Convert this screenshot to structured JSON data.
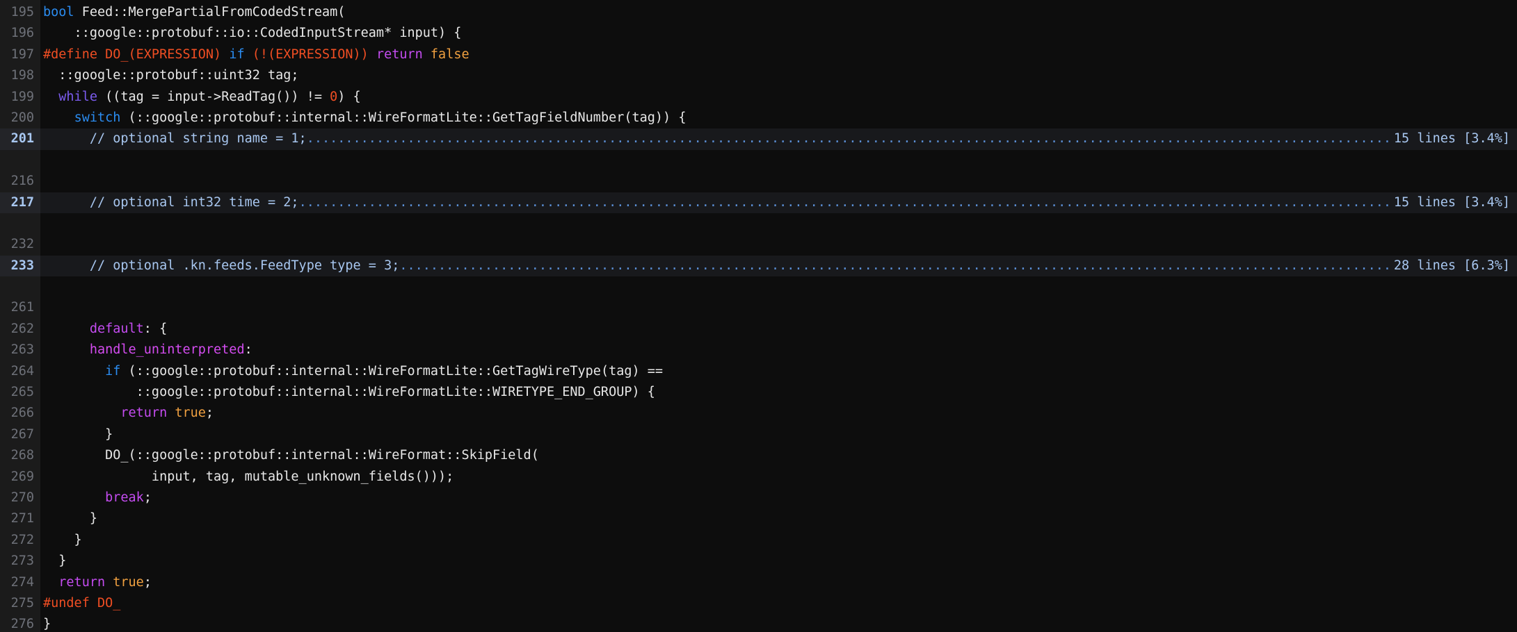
{
  "editor": {
    "theme": "dark",
    "language": "cpp",
    "font": "monospace",
    "colors": {
      "background": "#0d0d0d",
      "gutter_background": "#1b1b1b",
      "foreground": "#e8e8e8",
      "line_number": "#6e7179",
      "fold_text": "#a8c7f0",
      "fold_row_background": "#18191c",
      "preprocessor": "#f04e23",
      "type_keyword": "#2b8cf0",
      "control_keyword": "#c44cf0",
      "loop_keyword": "#7c5cf0",
      "constant": "#f0a040",
      "label": "#d44cf0"
    },
    "first_line": 195,
    "last_line": 276
  },
  "lines": [
    {
      "number": "195",
      "folded": false,
      "blank": false,
      "tokens": [
        {
          "text": "bool",
          "cls": "t-type"
        },
        {
          "text": " Feed::MergePartialFromCodedStream(",
          "cls": "t-plain"
        }
      ]
    },
    {
      "number": "196",
      "folded": false,
      "blank": false,
      "tokens": [
        {
          "text": "    ::google::protobuf::io::CodedInputStream* input) {",
          "cls": "t-plain"
        }
      ]
    },
    {
      "number": "197",
      "folded": false,
      "blank": false,
      "tokens": [
        {
          "text": "#define DO_(EXPRESSION) ",
          "cls": "t-pre"
        },
        {
          "text": "if",
          "cls": "t-type"
        },
        {
          "text": " ",
          "cls": "t-plain"
        },
        {
          "text": "(!(EXPRESSION))",
          "cls": "t-pre"
        },
        {
          "text": " ",
          "cls": "t-plain"
        },
        {
          "text": "return",
          "cls": "t-kw"
        },
        {
          "text": " ",
          "cls": "t-plain"
        },
        {
          "text": "false",
          "cls": "t-const"
        }
      ]
    },
    {
      "number": "198",
      "folded": false,
      "blank": false,
      "tokens": [
        {
          "text": "  ::google::protobuf::uint32 tag;",
          "cls": "t-plain"
        }
      ]
    },
    {
      "number": "199",
      "folded": false,
      "blank": false,
      "tokens": [
        {
          "text": "  ",
          "cls": "t-plain"
        },
        {
          "text": "while",
          "cls": "t-kw2"
        },
        {
          "text": " ((tag = input->ReadTag()) != ",
          "cls": "t-plain"
        },
        {
          "text": "0",
          "cls": "t-num"
        },
        {
          "text": ") {",
          "cls": "t-plain"
        }
      ]
    },
    {
      "number": "200",
      "folded": false,
      "blank": false,
      "tokens": [
        {
          "text": "    ",
          "cls": "t-plain"
        },
        {
          "text": "switch",
          "cls": "t-type"
        },
        {
          "text": " (::google::protobuf::internal::WireFormatLite::GetTagFieldNumber(tag)) {",
          "cls": "t-plain"
        }
      ]
    },
    {
      "number": "201",
      "folded": true,
      "blank": false,
      "fold_text": "      // optional string name = 1;",
      "fold_meta": "15 lines [3.4%]",
      "tokens": [
        {
          "text": "      // optional string name = 1;",
          "cls": "t-fold"
        }
      ]
    },
    {
      "number": "",
      "folded": false,
      "blank": true,
      "tokens": []
    },
    {
      "number": "216",
      "folded": false,
      "blank": false,
      "tokens": [
        {
          "text": "",
          "cls": "t-plain"
        }
      ]
    },
    {
      "number": "217",
      "folded": true,
      "blank": false,
      "fold_text": "      // optional int32 time = 2;",
      "fold_meta": "15 lines [3.4%]",
      "tokens": [
        {
          "text": "      // optional int32 time = 2;",
          "cls": "t-fold"
        }
      ]
    },
    {
      "number": "",
      "folded": false,
      "blank": true,
      "tokens": []
    },
    {
      "number": "232",
      "folded": false,
      "blank": false,
      "tokens": [
        {
          "text": "",
          "cls": "t-plain"
        }
      ]
    },
    {
      "number": "233",
      "folded": true,
      "blank": false,
      "fold_text": "      // optional .kn.feeds.FeedType type = 3;",
      "fold_meta": "28 lines [6.3%]",
      "tokens": [
        {
          "text": "      // optional .kn.feeds.FeedType type = 3;",
          "cls": "t-fold"
        }
      ]
    },
    {
      "number": "",
      "folded": false,
      "blank": true,
      "tokens": []
    },
    {
      "number": "261",
      "folded": false,
      "blank": false,
      "tokens": [
        {
          "text": "",
          "cls": "t-plain"
        }
      ]
    },
    {
      "number": "262",
      "folded": false,
      "blank": false,
      "tokens": [
        {
          "text": "      ",
          "cls": "t-plain"
        },
        {
          "text": "default",
          "cls": "t-kw"
        },
        {
          "text": ": {",
          "cls": "t-plain"
        }
      ]
    },
    {
      "number": "263",
      "folded": false,
      "blank": false,
      "tokens": [
        {
          "text": "      ",
          "cls": "t-plain"
        },
        {
          "text": "handle_uninterpreted",
          "cls": "t-label"
        },
        {
          "text": ":",
          "cls": "t-plain"
        }
      ]
    },
    {
      "number": "264",
      "folded": false,
      "blank": false,
      "tokens": [
        {
          "text": "        ",
          "cls": "t-plain"
        },
        {
          "text": "if",
          "cls": "t-type"
        },
        {
          "text": " (::google::protobuf::internal::WireFormatLite::GetTagWireType(tag) ==",
          "cls": "t-plain"
        }
      ]
    },
    {
      "number": "265",
      "folded": false,
      "blank": false,
      "tokens": [
        {
          "text": "            ::google::protobuf::internal::WireFormatLite::WIRETYPE_END_GROUP) {",
          "cls": "t-plain"
        }
      ]
    },
    {
      "number": "266",
      "folded": false,
      "blank": false,
      "tokens": [
        {
          "text": "          ",
          "cls": "t-plain"
        },
        {
          "text": "return",
          "cls": "t-kw"
        },
        {
          "text": " ",
          "cls": "t-plain"
        },
        {
          "text": "true",
          "cls": "t-const"
        },
        {
          "text": ";",
          "cls": "t-plain"
        }
      ]
    },
    {
      "number": "267",
      "folded": false,
      "blank": false,
      "tokens": [
        {
          "text": "        }",
          "cls": "t-plain"
        }
      ]
    },
    {
      "number": "268",
      "folded": false,
      "blank": false,
      "tokens": [
        {
          "text": "        DO_(::google::protobuf::internal::WireFormat::SkipField(",
          "cls": "t-plain"
        }
      ]
    },
    {
      "number": "269",
      "folded": false,
      "blank": false,
      "tokens": [
        {
          "text": "              input, tag, mutable_unknown_fields()));",
          "cls": "t-plain"
        }
      ]
    },
    {
      "number": "270",
      "folded": false,
      "blank": false,
      "tokens": [
        {
          "text": "        ",
          "cls": "t-plain"
        },
        {
          "text": "break",
          "cls": "t-kw"
        },
        {
          "text": ";",
          "cls": "t-plain"
        }
      ]
    },
    {
      "number": "271",
      "folded": false,
      "blank": false,
      "tokens": [
        {
          "text": "      }",
          "cls": "t-plain"
        }
      ]
    },
    {
      "number": "272",
      "folded": false,
      "blank": false,
      "tokens": [
        {
          "text": "    }",
          "cls": "t-plain"
        }
      ]
    },
    {
      "number": "273",
      "folded": false,
      "blank": false,
      "tokens": [
        {
          "text": "  }",
          "cls": "t-plain"
        }
      ]
    },
    {
      "number": "274",
      "folded": false,
      "blank": false,
      "tokens": [
        {
          "text": "  ",
          "cls": "t-plain"
        },
        {
          "text": "return",
          "cls": "t-kw"
        },
        {
          "text": " ",
          "cls": "t-plain"
        },
        {
          "text": "true",
          "cls": "t-const"
        },
        {
          "text": ";",
          "cls": "t-plain"
        }
      ]
    },
    {
      "number": "275",
      "folded": false,
      "blank": false,
      "tokens": [
        {
          "text": "#undef DO_",
          "cls": "t-pre"
        }
      ]
    },
    {
      "number": "276",
      "folded": false,
      "blank": false,
      "tokens": [
        {
          "text": "}",
          "cls": "t-plain"
        }
      ]
    }
  ]
}
